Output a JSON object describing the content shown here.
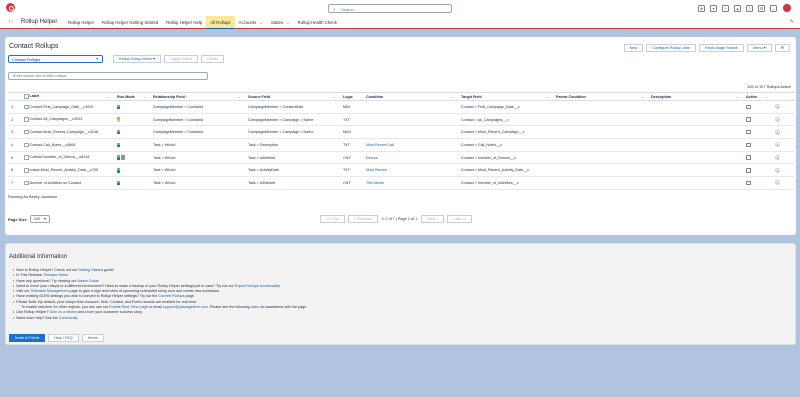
{
  "header": {
    "search_placeholder": "Search...",
    "app_name": "Rollup Helper",
    "nav": [
      {
        "label": "Rollup Helper",
        "chevron": false,
        "active": false
      },
      {
        "label": "Rollup Helper Getting Started",
        "chevron": false,
        "active": false
      },
      {
        "label": "Rollup Helper Help",
        "chevron": false,
        "active": false
      },
      {
        "label": "All Rollups",
        "chevron": false,
        "active": true
      },
      {
        "label": "Accounts",
        "chevron": true,
        "active": false
      },
      {
        "label": "States",
        "chevron": true,
        "active": false
      },
      {
        "label": "Rollup Health Check",
        "chevron": false,
        "active": false
      }
    ]
  },
  "main": {
    "title": "Contact Rollups",
    "header_buttons": [
      "New",
      "Configure Rollup Jobs",
      "Field Usage Search",
      "Menu"
    ],
    "object_select": "Contact Rollups",
    "filter_buttons": [
      "Rollup Group Menu",
      "Toggle Active",
      "Delete"
    ],
    "text_filter_placeholder": "Enter search text to filter rollups",
    "rollup_count": "105 of 107 Rollups Active",
    "columns": [
      "",
      "Label",
      "Run Mode",
      "Relationship Field",
      "Source Field",
      "Logic",
      "Condition",
      "Target Field",
      "Parent Condition",
      "Description",
      "Active",
      ""
    ],
    "rows": [
      {
        "num": "1",
        "label": "Contact.First_Campaign_Date__c3029",
        "run": "green",
        "rel": "CampaignMember > ContactId",
        "source": "CampaignMember > CreatedDate",
        "logic": "MIN",
        "condition": "",
        "target": "Contact > First_Campaign_Date__c",
        "parent": "",
        "desc": ""
      },
      {
        "num": "2",
        "label": "Contact.All_Campaigns__c3203",
        "run": "orange",
        "rel": "CampaignMember > ContactId",
        "source": "CampaignMember > Campaign > Name",
        "logic": "TXT",
        "condition": "",
        "target": "Contact > All_Campaigns__c",
        "parent": "",
        "desc": ""
      },
      {
        "num": "3",
        "label": "Contact.Most_Recent_Campaign__c3248",
        "run": "green",
        "rel": "CampaignMember > ContactId",
        "source": "CampaignMember > Campaign > Name",
        "logic": "MAX",
        "condition": "",
        "target": "Contact > Most_Recent_Campaign__c",
        "parent": "",
        "desc": ""
      },
      {
        "num": "4",
        "label": "Contact.Call_Notes__c4864",
        "run": "green",
        "rel": "Task > WhoId",
        "source": "Task > Description",
        "logic": "TXT",
        "condition": "Most Recent Call",
        "target": "Contact > Call_Notes__c",
        "parent": "",
        "desc": ""
      },
      {
        "num": "5",
        "label": "Contact.Number_of_Demos__c8218",
        "run": "green-gray",
        "rel": "Task > WhoId",
        "source": "Task > IsDeleted",
        "logic": "CNT",
        "condition": "Demos",
        "target": "Contact > Number_of_Demos__c",
        "parent": "",
        "desc": ""
      },
      {
        "num": "6",
        "label": "ontact.Most_Recent_Activity_Date__c700",
        "run": "green",
        "rel": "Task > WhoId",
        "source": "Task > ActivityDate",
        "logic": "TXT",
        "condition": "Most Recent",
        "target": "Contact > Most_Recent_Activity_Date__c",
        "parent": "",
        "desc": ""
      },
      {
        "num": "7",
        "label": "Number of Activities on Contact",
        "run": "green",
        "rel": "Task > WhoId",
        "source": "Task > IsDeleted",
        "logic": "CNT",
        "condition": "This Month",
        "target": "Contact > Number_of_Activities__c",
        "parent": "",
        "desc": ""
      }
    ],
    "running_as": "Running As Becky Jacobson",
    "page_size_label": "Page Size",
    "page_size": "100",
    "pager": {
      "first": "<< First",
      "prev": "< Previous",
      "info": "1-7 of 7 | Page 1 of 1",
      "next": "Next >",
      "last": "Last >>"
    }
  },
  "additional": {
    "title": "Additional Information",
    "items": [
      {
        "sub": false,
        "parts": [
          {
            "t": "New to Rollup Helper? Check out our ",
            "link": false
          },
          {
            "t": "Getting Started",
            "link": true
          },
          {
            "t": " guide!",
            "link": false
          }
        ]
      },
      {
        "sub": false,
        "parts": [
          {
            "t": "In This Release: ",
            "link": false
          },
          {
            "t": "Release Notes",
            "link": true
          }
        ]
      },
      {
        "sub": false,
        "parts": [
          {
            "t": "Have any questions? Try viewing our ",
            "link": false
          },
          {
            "t": "Admin Guide",
            "link": true
          }
        ]
      },
      {
        "sub": false,
        "parts": [
          {
            "t": "Need to move your rollups to a different environment? Need to make a backup of your Rollup Helper settings just in case? Try out our ",
            "link": false
          },
          {
            "t": "Export Rollups functionality",
            "link": true
          },
          {
            "t": "!",
            "link": false
          }
        ]
      },
      {
        "sub": false,
        "parts": [
          {
            "t": "Visit our ",
            "link": false
          },
          {
            "t": "Schedule Management",
            "link": true
          },
          {
            "t": " page to gain a high level view of upcoming scheduled rollup runs and create new schedules.",
            "link": false
          }
        ]
      },
      {
        "sub": false,
        "parts": [
          {
            "t": "Have existing DLRS settings you wish to convert to Rollup Helper settings? Try out the ",
            "link": false
          },
          {
            "t": "Convert Rollups",
            "link": true
          },
          {
            "t": " page.",
            "link": false
          }
        ]
      },
      {
        "sub": false,
        "parts": [
          {
            "t": "Please Note: By default, your rollups from Account, Task, Contact, and Event records are enabled for real-time.",
            "link": false
          }
        ]
      },
      {
        "sub": true,
        "parts": [
          {
            "t": "To enable real-time for other objects, you can use our ",
            "link": false
          },
          {
            "t": "Enable Real-Time page",
            "link": true
          },
          {
            "t": " or email ",
            "link": false
          },
          {
            "t": "support@passagetech.com",
            "link": true
          },
          {
            "t": ". Please see the following ",
            "link": false
          },
          {
            "t": "video",
            "link": true
          },
          {
            "t": " for assistance with the page.",
            "link": false
          }
        ]
      },
      {
        "sub": false,
        "parts": [
          {
            "t": "Like Rollup Helper? ",
            "link": false
          },
          {
            "t": "Give us a review",
            "link": true
          },
          {
            "t": " and ",
            "link": false
          },
          {
            "t": "share",
            "link": true
          },
          {
            "t": " your customer success story.",
            "link": false
          }
        ]
      },
      {
        "sub": false,
        "parts": [
          {
            "t": "Need more help? Ask the ",
            "link": false
          },
          {
            "t": "Community",
            "link": true
          },
          {
            "t": ".",
            "link": false
          }
        ]
      }
    ],
    "buttons": [
      "Invite A Friend",
      "Help / FAQ",
      "Home"
    ]
  }
}
